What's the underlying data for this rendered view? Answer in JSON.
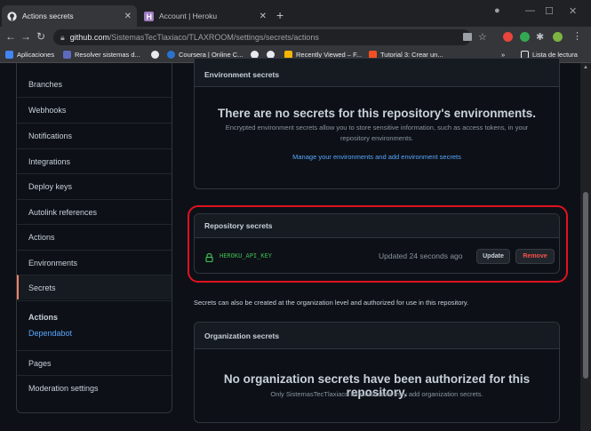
{
  "browser": {
    "tabs": [
      {
        "title": "Actions secrets",
        "active": true
      },
      {
        "title": "Account | Heroku",
        "active": false
      }
    ],
    "new_tab": "+",
    "url_host": "github.com",
    "url_path": "/SistemasTecTlaxiaco/TLAXROOM/settings/secrets/actions",
    "bookmarks": [
      "Aplicaciones",
      "Resolver sistemas d...",
      "Coursera | Online C...",
      "Recently Viewed – F...",
      "Tutorial 3: Crear un..."
    ],
    "more_bookmarks": "»",
    "reading_list": "Lista de lectura"
  },
  "sidebar": {
    "items": [
      "Branches",
      "Webhooks",
      "Notifications",
      "Integrations",
      "Deploy keys",
      "Autolink references",
      "Actions",
      "Environments",
      "Secrets"
    ],
    "selected": "Secrets",
    "secrets_subheading": "Actions",
    "secrets_sublink": "Dependabot",
    "items_after": [
      "Pages",
      "Moderation settings"
    ]
  },
  "environment_secrets": {
    "header": "Environment secrets",
    "title": "There are no secrets for this repository's environments.",
    "description": "Encrypted environment secrets allow you to store sensitive information, such as access tokens, in your repository environments.",
    "link": "Manage your environments and add environment secrets"
  },
  "repository_secrets": {
    "header": "Repository secrets",
    "secret_name": "HEROKU_API_KEY",
    "updated": "Updated 24 seconds ago",
    "update_label": "Update",
    "remove_label": "Remove"
  },
  "org_note": "Secrets can also be created at the organization level and authorized for use in this repository.",
  "organization_secrets": {
    "header": "Organization secrets",
    "title": "No organization secrets have been authorized for this repository.",
    "description": "Only SistemasTecTlaxiaco administrators may add organization secrets."
  },
  "colors": {
    "background": "#0d1117",
    "border": "#30363d",
    "accent_link": "#58a6ff",
    "secret_green": "#3fb950",
    "danger": "#f85149",
    "selected_marker": "#f78166",
    "annotation_red": "#e0121f"
  }
}
